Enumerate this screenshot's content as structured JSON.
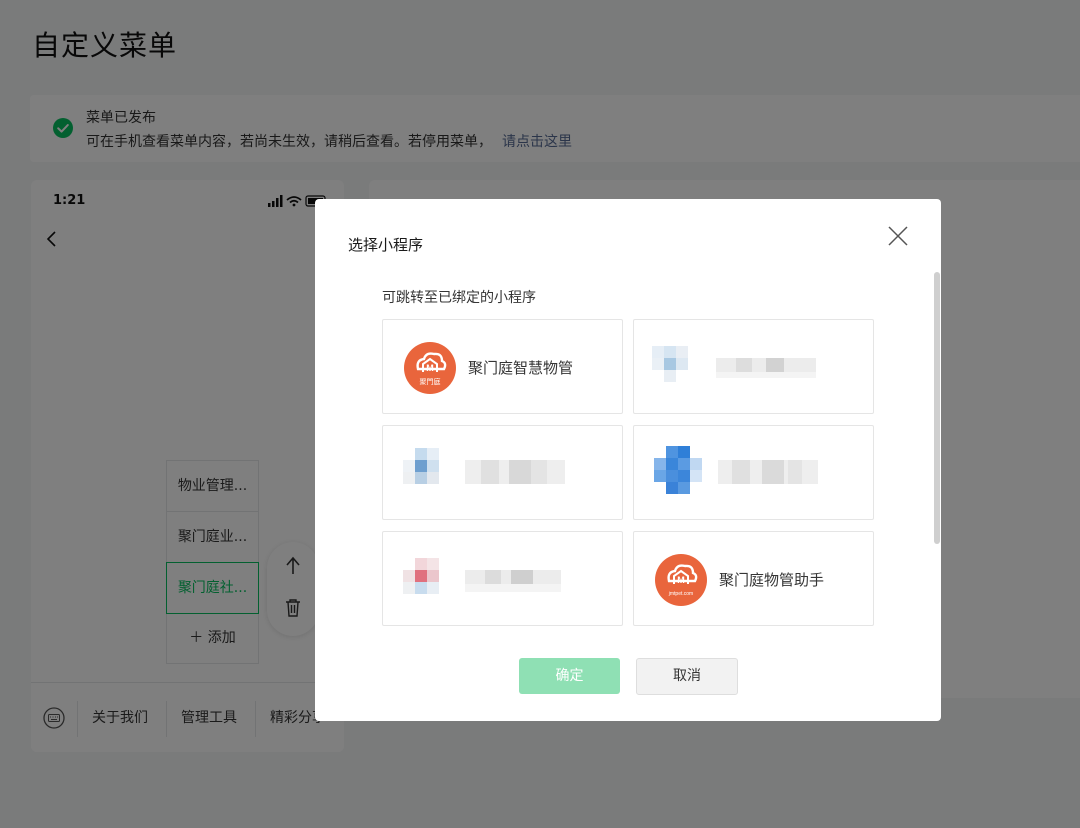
{
  "page": {
    "title": "自定义菜单"
  },
  "notice": {
    "title": "菜单已发布",
    "desc": "可在手机查看菜单内容，若尚未生效，请稍后查看。若停用菜单，",
    "link": "请点击这里",
    "icon": "check-circle-icon",
    "color": "#07c160"
  },
  "phone": {
    "time": "1:21",
    "submenu": [
      {
        "label": "物业管理..."
      },
      {
        "label": "聚门庭业..."
      },
      {
        "label": "聚门庭社...",
        "active": true
      }
    ],
    "add_label": "＋ 添加",
    "menubar": [
      "关于我们",
      "管理工具",
      "精彩分享"
    ]
  },
  "dialog": {
    "title": "选择小程序",
    "subtitle": "可跳转至已绑定的小程序",
    "apps": [
      {
        "name": "聚门庭智慧物管",
        "logo_text": "聚門庭",
        "blurred": false
      },
      {
        "name": "",
        "blurred": true
      },
      {
        "name": "",
        "blurred": true
      },
      {
        "name": "",
        "blurred": true
      },
      {
        "name": "",
        "blurred": true
      },
      {
        "name": "聚门庭物管助手",
        "logo_text": "jmtpet.com",
        "blurred": false
      }
    ],
    "confirm_label": "确定",
    "cancel_label": "取消",
    "confirm_color": "#8fe0b4",
    "logo_color": "#e9653c"
  }
}
